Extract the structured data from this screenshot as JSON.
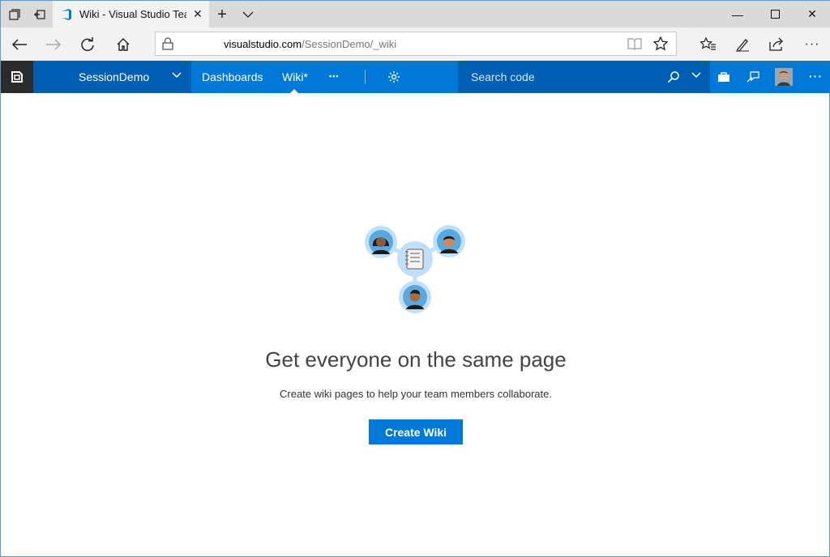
{
  "browser": {
    "tab_title": "Wiki - Visual Studio Tea",
    "url_domain": "visualstudio.com",
    "url_path": "/SessionDemo/_wiki"
  },
  "vsts": {
    "project": "SessionDemo",
    "hubs": [
      "Dashboards",
      "Wiki*"
    ],
    "more": "•••",
    "search_placeholder": "Search code",
    "accent": "#0078d7"
  },
  "main": {
    "headline": "Get everyone on the same page",
    "subtext": "Create wiki pages to help your team members collaborate.",
    "create_button": "Create Wiki"
  }
}
